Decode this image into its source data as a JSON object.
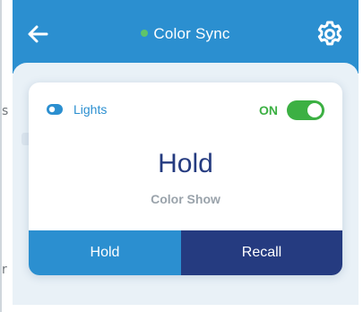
{
  "header": {
    "title": "Color Sync",
    "back_icon": "arrow-left-icon",
    "settings_icon": "gear-icon",
    "status_color": "#5fc46a",
    "background": "#2b8fd0"
  },
  "card": {
    "device_label": "Lights",
    "device_icon": "light-toggle-icon",
    "power_label": "ON",
    "power_on": true,
    "mode_title": "Hold",
    "mode_subtitle": "Color Show",
    "buttons": {
      "hold_label": "Hold",
      "recall_label": "Recall"
    }
  },
  "background_partial": {
    "left_char_top": "s",
    "left_char_bottom": "r"
  },
  "colors": {
    "accent": "#2b8fd0",
    "navy": "#253b80",
    "on_green": "#3cb043"
  }
}
